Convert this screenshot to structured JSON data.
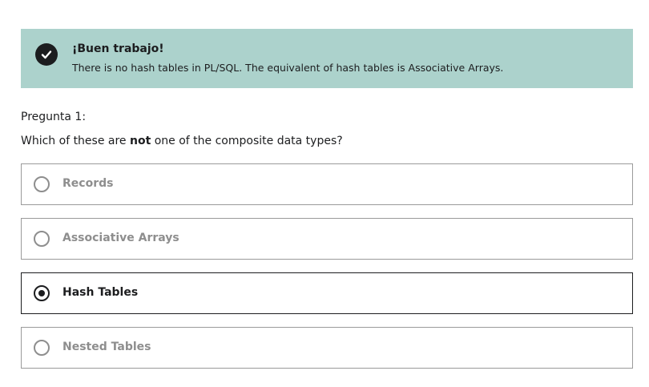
{
  "feedback": {
    "title": "¡Buen trabajo!",
    "message": "There is no hash tables in PL/SQL. The equivalent of hash tables is Associative Arrays.",
    "icon": "check-circle-icon",
    "background_color": "#acd2cc"
  },
  "question": {
    "label": "Pregunta 1:",
    "text_before": "Which of these are ",
    "text_emphasis": "not",
    "text_after": " one of the composite data types?"
  },
  "options": [
    {
      "label": "Records",
      "selected": false
    },
    {
      "label": "Associative Arrays",
      "selected": false
    },
    {
      "label": "Hash Tables",
      "selected": true
    },
    {
      "label": "Nested Tables",
      "selected": false
    }
  ]
}
